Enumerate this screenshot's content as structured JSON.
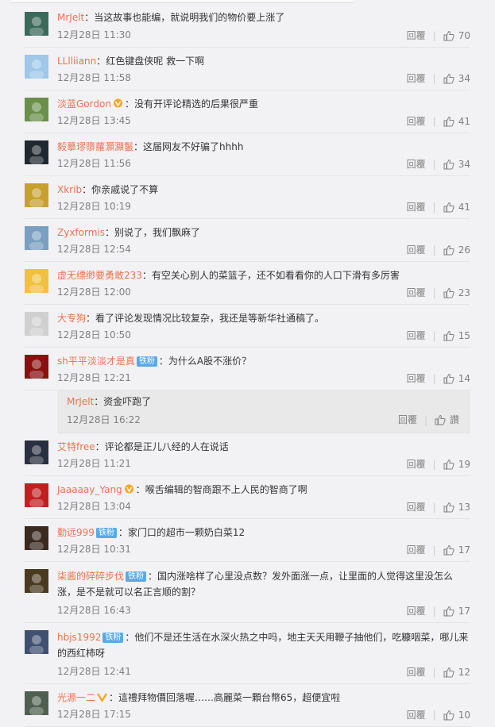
{
  "comments": [
    {
      "name": "MrJelt",
      "text": "当这故事也能编，就说明我们的物价要上涨了",
      "time": "12月28日 11:30",
      "likes": "70"
    },
    {
      "name": "LLlliiann",
      "text": "红色键盘侠呢 救一下啊",
      "time": "12月28日 11:58",
      "likes": "34"
    },
    {
      "name": "淡蓝Gordon",
      "text": "没有开评论精选的后果很严重",
      "time": "12月28日 13:45",
      "likes": "41"
    },
    {
      "name": "毅摹璆隳蘿灝灦鬣",
      "text": "这届网友不好骗了hhhh",
      "time": "12月28日 11:56",
      "likes": "34"
    },
    {
      "name": "Xkrib",
      "text": "你亲戚说了不算",
      "time": "12月28日 10:19",
      "likes": "41"
    },
    {
      "name": "Zyxformis",
      "text": "别说了，我们飘麻了",
      "time": "12月28日 12:54",
      "likes": "26"
    },
    {
      "name": "虚无缥缈要勇敢233",
      "text": "有空关心别人的菜篮子，还不如看看你的人口下滑有多厉害",
      "time": "12月28日 12:00",
      "likes": "23"
    },
    {
      "name": "大专狗",
      "text": "看了评论发现情况比较复杂，我还是等新华社通稿了。",
      "time": "12月28日 10:50",
      "likes": "15"
    },
    {
      "name": "sh平平淡淡才是真",
      "badge": "铁粉",
      "text": "为什么A股不涨价？",
      "time": "12月28日 12:21",
      "likes": "14"
    },
    {
      "name": "艾特free",
      "text": "评论都是正儿八经的人在说话",
      "time": "12月28日 11:21",
      "likes": "19"
    },
    {
      "name": "Jaaaaay_Yang",
      "text": "喉舌编辑的智商跟不上人民的智商了啊",
      "time": "12月28日 13:04",
      "likes": "13"
    },
    {
      "name": "勤远999",
      "badge": "铁粉",
      "text": "家门口的超市一颗奶白菜12",
      "time": "12月28日 10:31",
      "likes": "17"
    },
    {
      "name": "柒酱的碎碎步伐",
      "badge": "铁粉",
      "text": "国内涨啥样了心里没点数？发外面涨一点，让里面的人觉得这里没怎么涨，是不是就可以名正言顺的割？",
      "time": "12月28日 16:43",
      "likes": "17"
    },
    {
      "name": "hbjs1992",
      "badge": "铁粉",
      "text": "他们不是还生活在水深火热之中吗，地主天天用鞭子抽他们，吃糠咽菜，哪儿来的西红柿呀",
      "time": "12月28日 12:41",
      "likes": "12"
    },
    {
      "name": "光源一二",
      "text": "這禮拜物價回落喔……高麗菜一顆台幣65，超便宜啦",
      "time": "12月28日 17:15",
      "likes": "10"
    }
  ],
  "subreply": {
    "name": "MrJelt",
    "text": "资金吓跑了",
    "time": "12月28日 16:22",
    "likes": "讚"
  },
  "labels": {
    "reply": "回覆",
    "sep": "：",
    "divider": "|"
  }
}
